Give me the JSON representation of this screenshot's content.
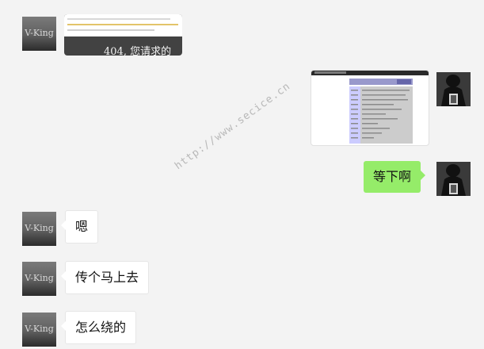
{
  "contact": {
    "avatar_text": "V-King"
  },
  "messages": [
    {
      "side": "left",
      "type": "image",
      "caption_text": "404, 您请求的"
    },
    {
      "side": "right",
      "type": "image"
    },
    {
      "side": "right",
      "type": "text",
      "text": "等下啊"
    },
    {
      "side": "left",
      "type": "text",
      "text": "嗯"
    },
    {
      "side": "left",
      "type": "text",
      "text": "传个马上去"
    },
    {
      "side": "left",
      "type": "text",
      "text": "怎么绕的"
    }
  ],
  "watermark": "http://www.secice.cn",
  "colors": {
    "background": "#f3f3f3",
    "bubble_self": "#95ec69",
    "bubble_other": "#ffffff"
  }
}
